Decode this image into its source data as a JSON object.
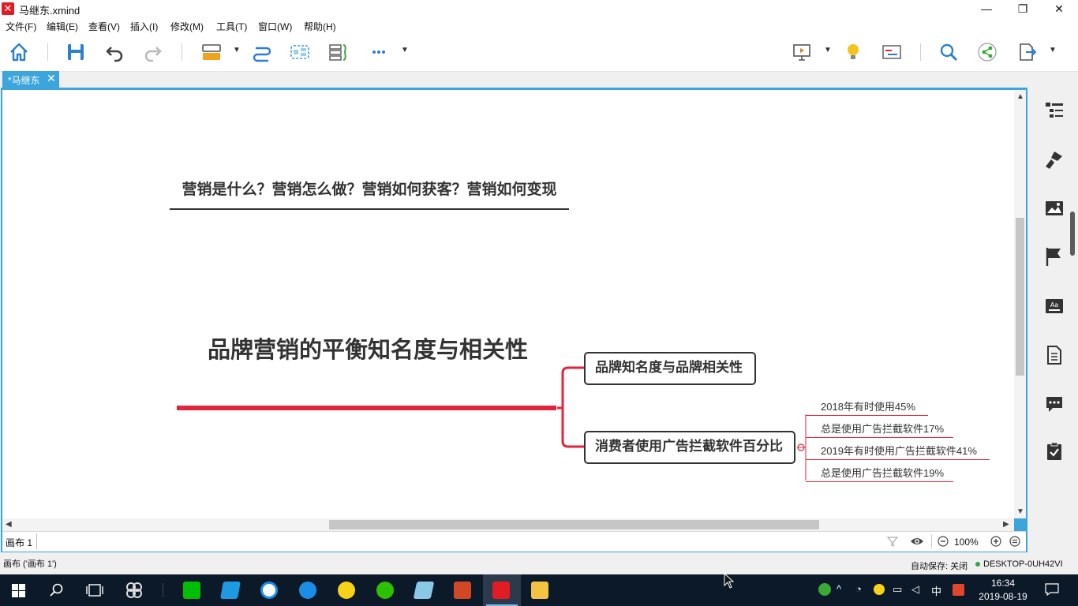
{
  "window": {
    "title": "马继东.xmind",
    "app_icon": "xmind-icon",
    "controls": [
      "minimize",
      "maximize",
      "close"
    ],
    "control_glyphs": {
      "minimize": "—",
      "maximize": "❐",
      "close": "✕"
    }
  },
  "menu": {
    "items": [
      "文件(F)",
      "编辑(E)",
      "查看(V)",
      "插入(I)",
      "修改(M)",
      "工具(T)",
      "窗口(W)",
      "帮助(H)"
    ]
  },
  "toolbar": {
    "left_icons": [
      "home-icon",
      "save-icon",
      "undo-icon",
      "redo-icon",
      "topic-icon",
      "relationship-icon",
      "boundary-icon",
      "summary-icon",
      "more-icon"
    ],
    "right_icons": [
      "presentation-icon",
      "brainstorm-icon",
      "gantt-icon",
      "search-icon",
      "share-icon",
      "export-icon"
    ]
  },
  "tabs": [
    {
      "label": "*马继东",
      "active": true
    }
  ],
  "mindmap": {
    "floating_topic": "营销是什么？营销怎么做？营销如何获客？营销如何变现",
    "central_topic": "品牌营销的平衡知名度与相关性",
    "main_topics": [
      {
        "label": "品牌知名度与品牌相关性"
      },
      {
        "label": "消费者使用广告拦截软件百分比",
        "children": [
          "2018年有时使用45%",
          "总是使用广告拦截软件17%",
          "2019年有时使用广告拦截软件41%",
          "总是使用广告拦截软件19%"
        ]
      }
    ],
    "accent_color": "#e0263d"
  },
  "canvas_bar": {
    "sheet_tab": "画布 1",
    "zoom": "100%"
  },
  "statusbar": {
    "left": "画布 ('画布 1')",
    "autosave": "自动保存: 关闭",
    "host": "DESKTOP-0UH42VI"
  },
  "side_panel": {
    "icons": [
      "outline-icon",
      "format-brush-icon",
      "image-icon",
      "marker-flag-icon",
      "text-style-icon",
      "notes-icon",
      "comment-icon",
      "task-icon"
    ]
  },
  "taskbar": {
    "apps": [
      "start-icon",
      "search-icon",
      "task-view-icon",
      "app-pinwheel-icon",
      "iqiyi-icon",
      "paint-icon",
      "qq-browser-icon",
      "kugou-icon",
      "plus-app-icon",
      "wechat-icon",
      "notes-app-icon",
      "powerpoint-icon",
      "xmind-icon",
      "file-explorer-icon"
    ],
    "time": "16:34",
    "date": "2019-08-19",
    "ime": "中"
  }
}
